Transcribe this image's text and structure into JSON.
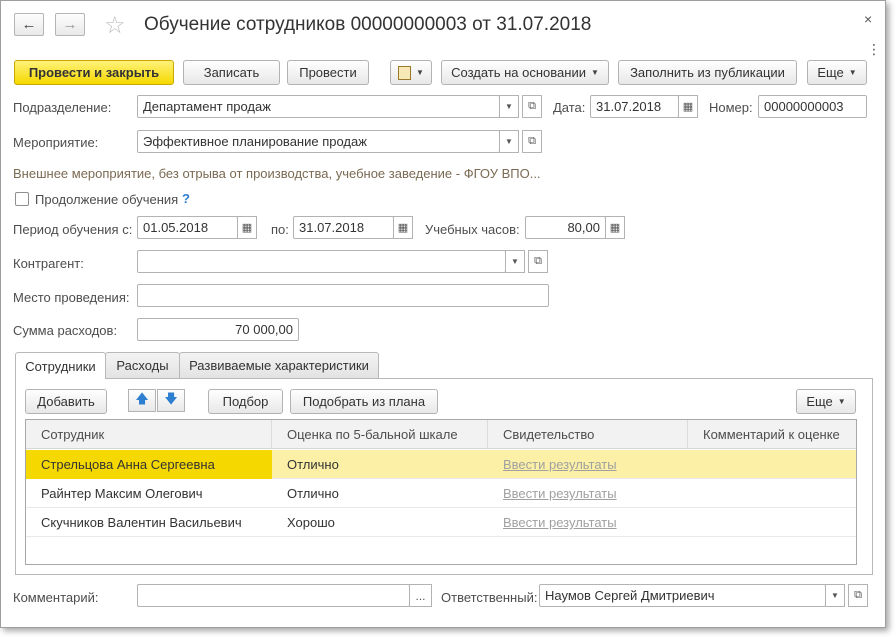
{
  "window": {
    "title": "Обучение сотрудников 00000000003 от 31.07.2018",
    "back_icon": "arrow-left-icon",
    "forward_icon": "arrow-right-icon",
    "close_glyph": "×",
    "menu_glyph": "⋮"
  },
  "toolbar": {
    "post_close": "Провести и закрыть",
    "save": "Записать",
    "post": "Провести",
    "create_based": "Создать на основании",
    "fill_from_pub": "Заполнить из публикации",
    "more": "Еще"
  },
  "form": {
    "department_label": "Подразделение:",
    "department_value": "Департамент продаж",
    "date_label": "Дата:",
    "date_value": "31.07.2018",
    "number_label": "Номер:",
    "number_value": "00000000003",
    "event_label": "Мероприятие:",
    "event_value": "Эффективное планирование продаж",
    "event_hint": "Внешнее мероприятие, без отрыва от производства, учебное заведение - ФГОУ ВПО...",
    "continuation_label": "Продолжение обучения",
    "continuation_checked": false,
    "question": "?",
    "period_label": "Период обучения с:",
    "period_from": "01.05.2018",
    "period_to_label": "по:",
    "period_to": "31.07.2018",
    "hours_label": "Учебных часов:",
    "hours_value": "80,00",
    "contractor_label": "Контрагент:",
    "contractor_value": "",
    "place_label": "Место проведения:",
    "place_value": "",
    "expenses_label": "Сумма расходов:",
    "expenses_value": "70 000,00",
    "comment_label": "Комментарий:",
    "comment_value": "",
    "responsible_label": "Ответственный:",
    "responsible_value": "Наумов Сергей Дмитриевич"
  },
  "tabs": [
    {
      "label": "Сотрудники"
    },
    {
      "label": "Расходы"
    },
    {
      "label": "Развиваемые характеристики"
    }
  ],
  "table_toolbar": {
    "add": "Добавить",
    "select": "Подбор",
    "select_plan": "Подобрать из плана",
    "more": "Еще"
  },
  "table": {
    "columns": [
      "Сотрудник",
      "Оценка по 5-бальной шкале",
      "Свидетельство",
      "Комментарий к оценке"
    ],
    "rows": [
      {
        "employee": "Стрельцова Анна Сергеевна",
        "grade": "Отлично",
        "cert": "Ввести результаты",
        "comment": ""
      },
      {
        "employee": "Райнтер Максим Олегович",
        "grade": "Отлично",
        "cert": "Ввести результаты",
        "comment": ""
      },
      {
        "employee": "Скучников Валентин Васильевич",
        "grade": "Хорошо",
        "cert": "Ввести результаты",
        "comment": ""
      }
    ]
  },
  "colors": {
    "primary_button": "#f5d800",
    "selected_row": "#fbf0a6",
    "link": "#a0a0a0",
    "hint": "#7a6a52"
  }
}
